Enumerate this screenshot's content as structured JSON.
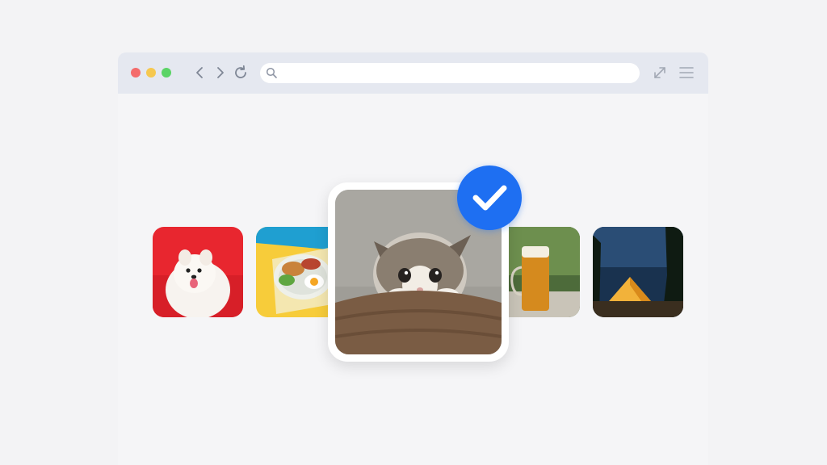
{
  "browser": {
    "window_controls": [
      "close",
      "minimize",
      "maximize"
    ],
    "nav": {
      "back_icon": "chevron-left-icon",
      "forward_icon": "chevron-right-icon",
      "reload_icon": "reload-icon"
    },
    "address_bar": {
      "value": "",
      "placeholder": "",
      "icon": "search-icon"
    },
    "actions": [
      "expand-icon",
      "menu-icon"
    ]
  },
  "gallery": {
    "images": [
      {
        "subject": "pomeranian-dog",
        "selected": false
      },
      {
        "subject": "breakfast-plate",
        "selected": false
      },
      {
        "subject": "kitten",
        "selected": true
      },
      {
        "subject": "beer-mug",
        "selected": false
      },
      {
        "subject": "camping-tent",
        "selected": false
      }
    ],
    "selected_badge_icon": "checkmark-icon"
  },
  "colors": {
    "accent": "#1e6ff2",
    "titlebar": "#e5e8f0",
    "close": "#f46b6b",
    "minimize": "#f6c84f",
    "maximize": "#5bd466"
  }
}
